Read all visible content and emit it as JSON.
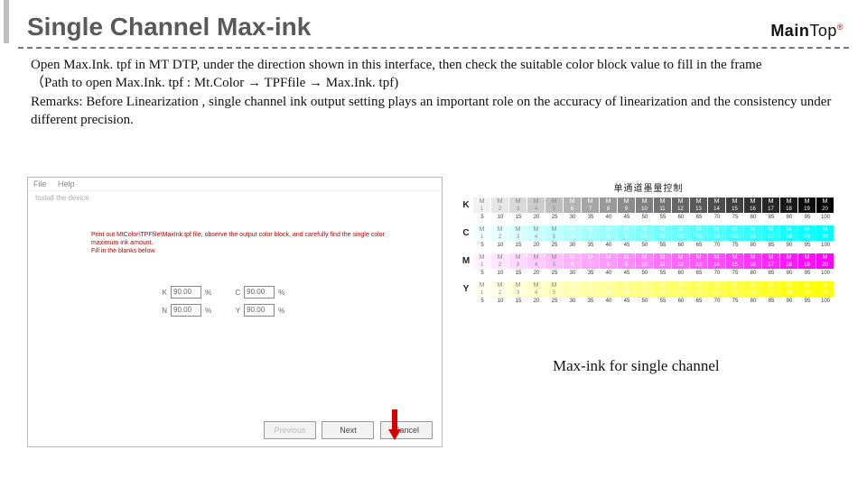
{
  "slide": {
    "title": "Single Channel Max-ink",
    "logo_main": "Main",
    "logo_top": "Top",
    "body1": "Open Max.Ink. tpf in MT DTP, under the direction shown in this interface, then check the suitable color block value to fill in the frame",
    "body2": "（Path to open Max.Ink. tpf : Mt.Color → TPFfile → Max.Ink. tpf)",
    "body3": "Remarks: Before Linearization , single channel ink output setting plays an important role on the accuracy of linearization and the consistency under different precision."
  },
  "dialog": {
    "menu_file": "File",
    "menu_help": "Help",
    "subline": "Install the device",
    "instr_line1": "Print out MtColor\\TPFfile\\MaxInk.tpf file, observe the output color block, and carefully find the single color maximum ink amount.",
    "instr_line2": "Fill in the blanks below.",
    "labels": [
      "K",
      "N",
      "C",
      "Y"
    ],
    "values": [
      "90.00",
      "90.00",
      "90.00",
      "90.00"
    ],
    "pct": "%",
    "btn_prev": "Previous",
    "btn_next": "Next",
    "btn_cancel": "Cancel"
  },
  "chart": {
    "title": "单通道墨量控制",
    "rows": [
      "K",
      "C",
      "M",
      "Y"
    ],
    "steps": [
      5,
      10,
      15,
      20,
      25,
      30,
      35,
      40,
      45,
      50,
      55,
      60,
      65,
      70,
      75,
      80,
      85,
      90,
      95,
      100
    ],
    "chip_mark": "M",
    "caption": "Max-ink for single channel",
    "chart_data": {
      "type": "table",
      "title": "单通道墨量控制 (Single-channel ink control)",
      "channels": [
        "K",
        "C",
        "M",
        "Y"
      ],
      "percent_steps": [
        5,
        10,
        15,
        20,
        25,
        30,
        35,
        40,
        45,
        50,
        55,
        60,
        65,
        70,
        75,
        80,
        85,
        90,
        95,
        100
      ]
    }
  }
}
